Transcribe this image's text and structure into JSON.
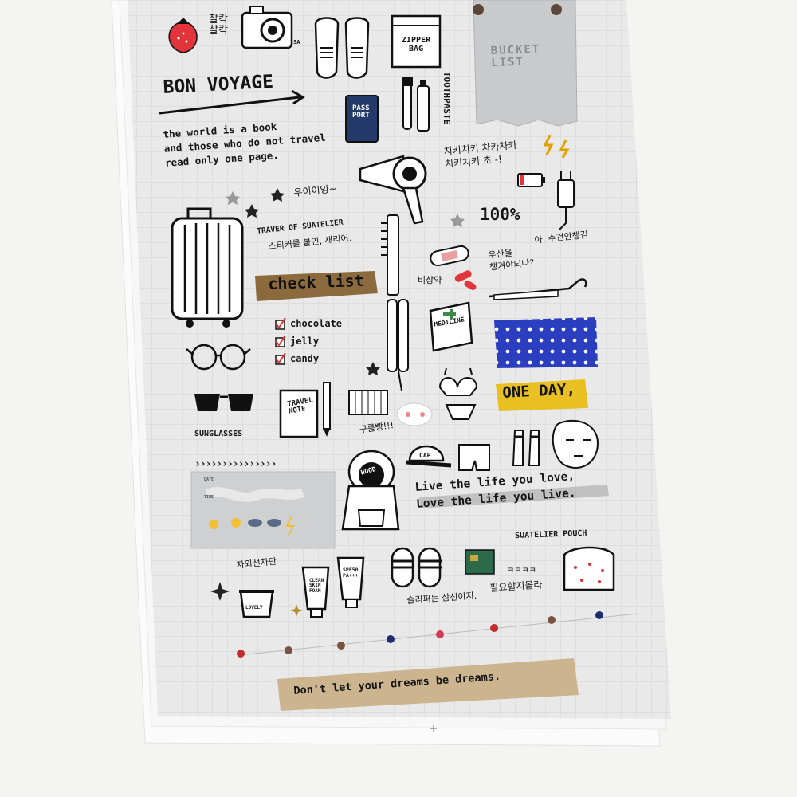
{
  "sheet": {
    "bucket_list": "BUCKET\nLIST",
    "bon_voyage": "BON VOYAGE",
    "zipper_bag": "ZIPPER\nBAG",
    "toothpaste": "TOOTHPASTE",
    "passport": "PASS\nPORT",
    "korean_top": "찰칵\n찰칵",
    "camera_mark": "SA",
    "book_quote": "the world is a book\nand those who do not travel\nread only one page.",
    "chichi": "치키치키 차카차카\n치키치키 초 -!",
    "uiii": "우이이잉~",
    "hundred": "100%",
    "traveler_title": "TRAVER OF SUATELIER",
    "traveler_sub": "스티커를 붙인, 새리어.",
    "umbrella_line": "아, 수건안챙김",
    "umbrella_q": "우산을\n챙겨야되나?",
    "medkit_label": "비상약",
    "check_list": "check list",
    "checklist_items": [
      "chocolate",
      "jelly",
      "candy"
    ],
    "medicine": "MEDICINE",
    "one_day": "ONE DAY,",
    "sunglasses": "SUNGLASSES",
    "travel_note": "TRAVEL\nNOTE",
    "gurume": "구름빵!!!",
    "hood": "HOOD",
    "cap": "CAP",
    "live_quote": "Live the life you love,\nLove the life you live.",
    "weather_arrows": "›››››››››››››››",
    "weather_date": "DATE",
    "weather_time": "TIME",
    "pouch": "SUATELIER POUCH",
    "sunscreen_label": "자외선차단",
    "clean_skin": "CLEAN\nSKIN\nFOAM",
    "spf": "SPF50\nPA+++",
    "lovely": "LOVELY",
    "slipper_line": "슬리퍼는 삼선이지.",
    "kkk": "ㅋㅋㅋㅋ",
    "need": "필요할지몰라",
    "dreams": "Don't let your dreams be dreams."
  },
  "colors": {
    "background": "#f4f4f3",
    "sheet": "#e9e9e9",
    "grid": "#d4d4d4",
    "tape_brown": "#8b6a3e",
    "tape_blue": "#2c3ec0",
    "tape_yellow": "#e8c022",
    "tape_beige": "#cbb48e",
    "strawberry": "#e3343c",
    "dot_red": "#c22c2a",
    "dot_brown": "#7a5243",
    "dot_navy": "#1f2b6e",
    "dot_rose": "#d43a56"
  }
}
